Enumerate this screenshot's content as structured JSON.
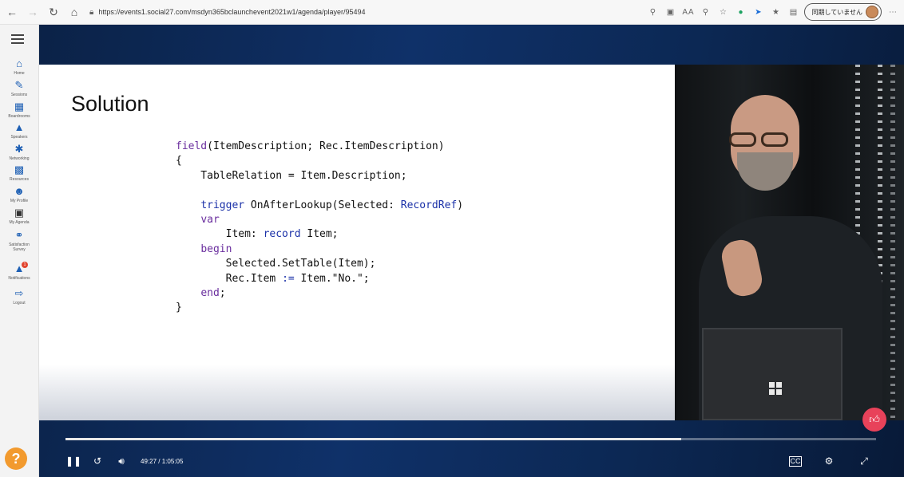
{
  "browser": {
    "url": "https://events1.social27.com/msdyn365bclaunchevent2021w1/agenda/player/95494",
    "profile_label": "同期していません",
    "icons": [
      "back-icon",
      "forward-icon",
      "refresh-icon",
      "home-icon",
      "lock-icon",
      "search-icon",
      "reader-icon",
      "read-aloud-icon",
      "zoom-icon",
      "favorite-add-icon",
      "extension-green-icon",
      "extension-blue-icon",
      "favorites-icon",
      "collections-icon",
      "more-icon"
    ]
  },
  "sidebar": {
    "items": [
      {
        "label": "Home",
        "icon": "home-icon"
      },
      {
        "label": "Sessions",
        "icon": "pencil-icon"
      },
      {
        "label": "Boardrooms",
        "icon": "boardroom-icon"
      },
      {
        "label": "Speakers",
        "icon": "speaker-icon"
      },
      {
        "label": "Networking",
        "icon": "networking-icon"
      },
      {
        "label": "Resources",
        "icon": "resources-icon"
      },
      {
        "label": "My Profile",
        "icon": "profile-icon"
      },
      {
        "label": "My Agenda",
        "icon": "agenda-icon"
      },
      {
        "label": "Satisfaction Survey",
        "icon": "survey-icon"
      },
      {
        "label": "Notifications",
        "icon": "bell-icon"
      },
      {
        "label": "Logout",
        "icon": "logout-icon"
      }
    ],
    "notification_count": "1",
    "help_label": "?"
  },
  "slide": {
    "title": "Solution"
  },
  "player": {
    "current_time": "49:27",
    "total_time": "1:05:05",
    "separator": "/",
    "progress": 0.76
  },
  "colors": {
    "keyword": "#1b31a8",
    "keyword_alt": "#6a2e9e",
    "help": "#f29a2e",
    "like": "#e8425a"
  }
}
